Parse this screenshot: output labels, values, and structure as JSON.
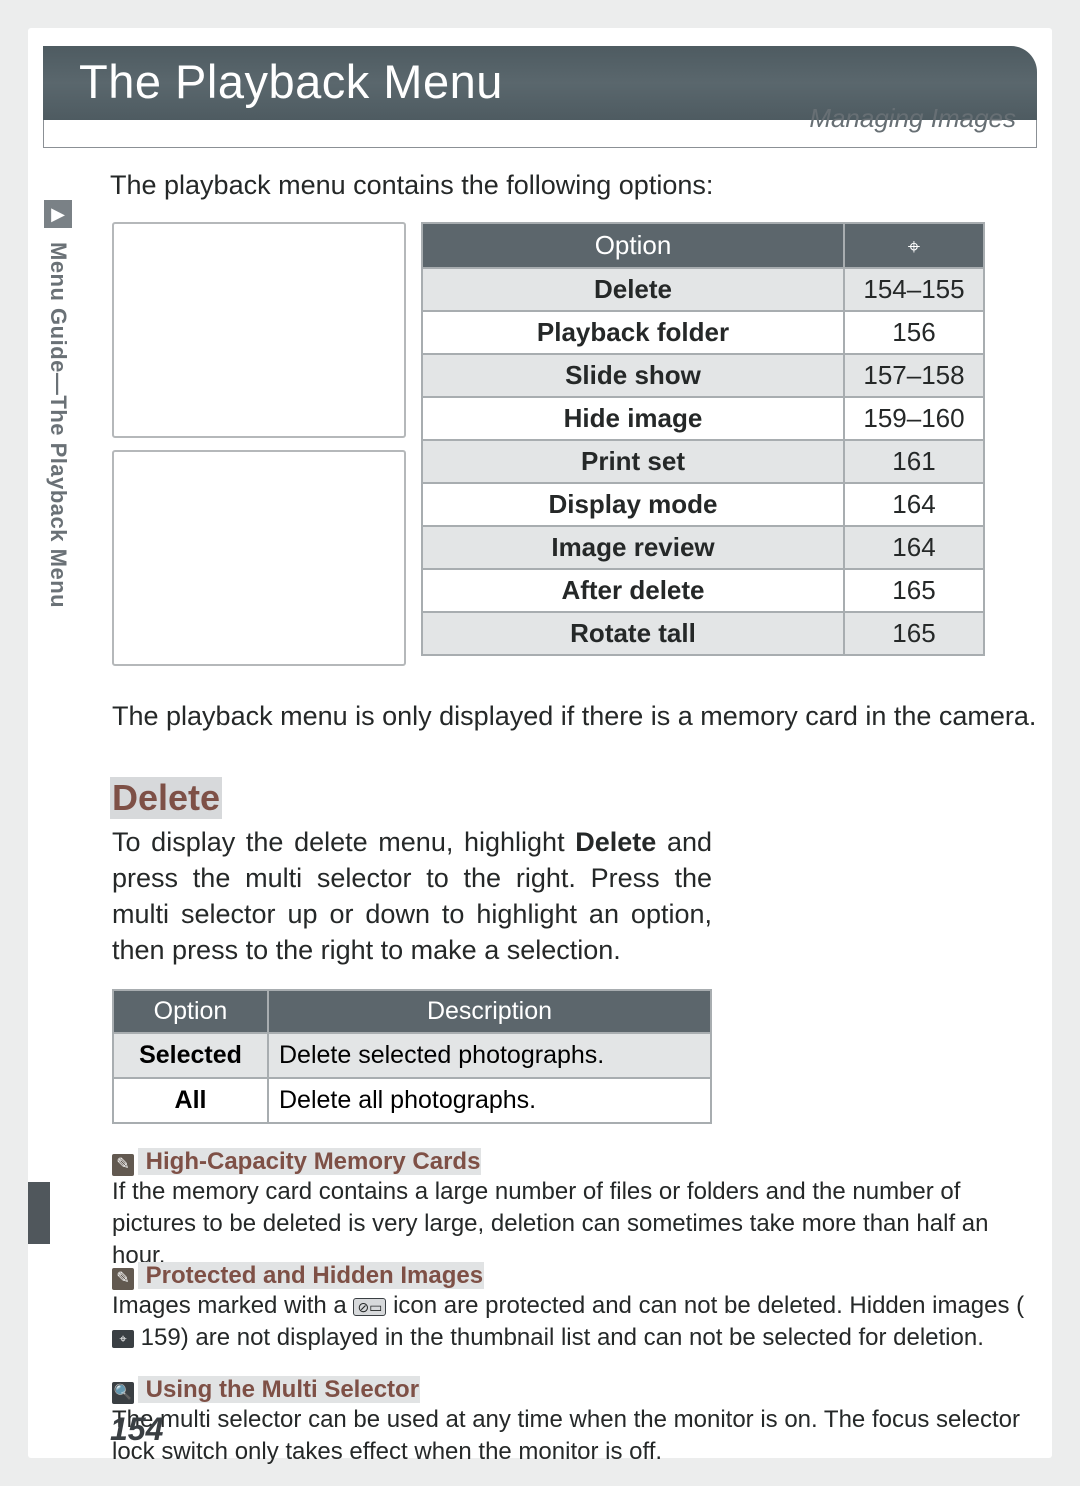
{
  "header": {
    "title": "The Playback Menu",
    "subtitle": "Managing Images"
  },
  "intro": "The playback menu contains the following options:",
  "sidebar": {
    "icon_label": "▸",
    "text": "Menu Guide—The Playback Menu"
  },
  "options_table": {
    "head_option": "Option",
    "rows": [
      {
        "option": "Delete",
        "page": "154–155"
      },
      {
        "option": "Playback folder",
        "page": "156"
      },
      {
        "option": "Slide show",
        "page": "157–158"
      },
      {
        "option": "Hide image",
        "page": "159–160"
      },
      {
        "option": "Print set",
        "page": "161"
      },
      {
        "option": "Display mode",
        "page": "164"
      },
      {
        "option": "Image review",
        "page": "164"
      },
      {
        "option": "After delete",
        "page": "165"
      },
      {
        "option": "Rotate tall",
        "page": "165"
      }
    ]
  },
  "memory_note": "The playback menu is only displayed if there is a memory card in the camera.",
  "delete_section": {
    "heading": "Delete",
    "para_pre": "To display the delete menu, highlight ",
    "para_bold": "Delete",
    "para_post": " and press the multi selector to the right.  Press the multi selector up or down to highlight an option, then press to the right to make a selection."
  },
  "delete_table": {
    "head_option": "Option",
    "head_desc": "Description",
    "rows": [
      {
        "option": "Selected",
        "desc": "Delete selected photographs."
      },
      {
        "option": "All",
        "desc": "Delete all photographs."
      }
    ]
  },
  "notes": {
    "n1": {
      "title": " High-Capacity Memory Cards",
      "body": "If the memory card contains a large number of files or folders and the number of pictures to be deleted is very large, deletion can sometimes take more than half an hour."
    },
    "n2": {
      "title": " Protected and Hidden Images",
      "body_pre": "Images marked with a ",
      "body_mid": " icon are protected and can not be deleted.  Hidden images (",
      "body_ref": " 159) are not displayed in the thumbnail list and can not be selected for deletion."
    },
    "n3": {
      "title": " Using the Multi Selector",
      "body": "The multi selector can be used at any time when the monitor is on.  The focus selector lock switch only takes effect when the monitor is off."
    }
  },
  "icons": {
    "protect": "⊘▭",
    "camera": "⌖"
  },
  "page_number": "154"
}
